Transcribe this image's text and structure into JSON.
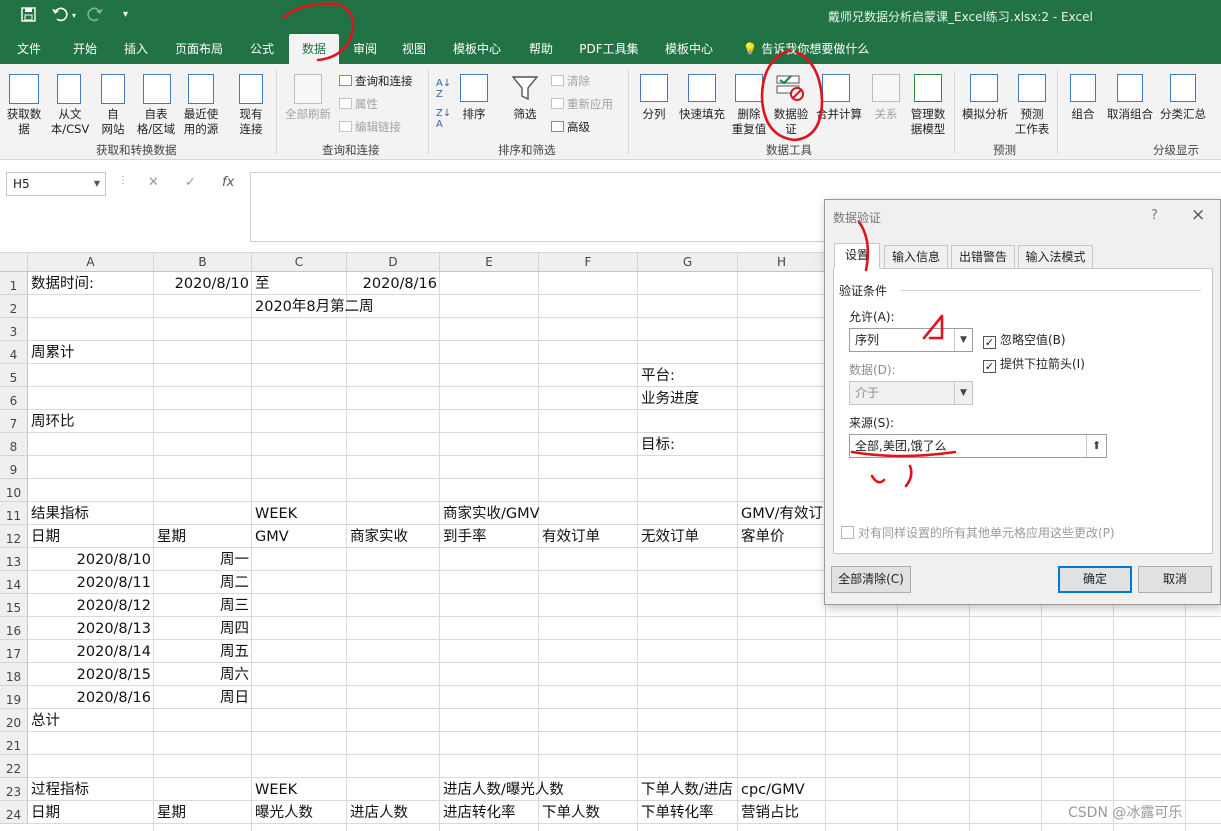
{
  "titlebar": {
    "title": "戴师兄数据分析启蒙课_Excel练习.xlsx:2  -  Excel",
    "icons": [
      "save-icon",
      "undo-icon",
      "redo-icon",
      "customize-qat-icon"
    ]
  },
  "tabs": [
    "文件",
    "开始",
    "插入",
    "页面布局",
    "公式",
    "数据",
    "审阅",
    "视图",
    "模板中心",
    "帮助",
    "PDF工具集",
    "模板中心",
    "告诉我你想要做什么"
  ],
  "active_tab": "数据",
  "ribbon": {
    "get_transform": {
      "label": "获取和转换数据",
      "buttons": [
        "获取数\n据",
        "从文\n本/CSV",
        "自\n网站",
        "自表\n格/区域",
        "最近使\n用的源",
        "现有\n连接"
      ]
    },
    "queries": {
      "label": "查询和连接",
      "refresh": "全部刷新",
      "items": [
        "查询和连接",
        "属性",
        "编辑链接"
      ]
    },
    "sort_filter": {
      "label": "排序和筛选",
      "sort": "排序",
      "filter": "筛选",
      "items": [
        "清除",
        "重新应用",
        "高级"
      ]
    },
    "data_tools": {
      "label": "数据工具",
      "buttons": [
        "分列",
        "快速填充",
        "删除\n重复值",
        "数据验\n证",
        "合并计算",
        "关系",
        "管理数\n据模型"
      ]
    },
    "forecast": {
      "label": "预测",
      "buttons": [
        "模拟分析",
        "预测\n工作表"
      ]
    },
    "outline": {
      "label": "分级显示",
      "buttons": [
        "组合",
        "取消组合",
        "分类汇总"
      ]
    }
  },
  "formula_bar": {
    "name_box": "H5",
    "formula": ""
  },
  "columns": [
    "A",
    "B",
    "C",
    "D",
    "E",
    "F",
    "G",
    "H"
  ],
  "rows": [
    "1",
    "2",
    "3",
    "4",
    "5",
    "6",
    "7",
    "8",
    "9",
    "10",
    "11",
    "12",
    "13",
    "14",
    "15",
    "16",
    "17",
    "18",
    "19",
    "20",
    "21",
    "22",
    "23",
    "24"
  ],
  "cells": {
    "A1": "数据时间:",
    "B1": "2020/8/10",
    "C1": "至",
    "D1": "2020/8/16",
    "C2": "2020年8月第二周",
    "A4": "周累计",
    "G5": "平台:",
    "G6": "业务进度",
    "A7": "周环比",
    "G8": "目标:",
    "A11": "结果指标",
    "C11": "WEEK",
    "E11": "商家实收/GMV",
    "H11": "GMV/有效订",
    "A12": "日期",
    "B12": "星期",
    "C12": "GMV",
    "D12": "商家实收",
    "E12": "到手率",
    "F12": "有效订单",
    "G12": "无效订单",
    "H12": "客单价",
    "A13": "2020/8/10",
    "B13": "周一",
    "A14": "2020/8/11",
    "B14": "周二",
    "A15": "2020/8/12",
    "B15": "周三",
    "A16": "2020/8/13",
    "B16": "周四",
    "A17": "2020/8/14",
    "B17": "周五",
    "A18": "2020/8/15",
    "B18": "周六",
    "A19": "2020/8/16",
    "B19": "周日",
    "A20": "总计",
    "A23": "过程指标",
    "C23": "WEEK",
    "E23": "进店人数/曝光人数",
    "G23": "下单人数/进店",
    "H23": "cpc/GMV",
    "A24": "日期",
    "B24": "星期",
    "C24": "曝光人数",
    "D24": "进店人数",
    "E24": "进店转化率",
    "F24": "下单人数",
    "G24": "下单转化率",
    "H24": "营销占比"
  },
  "dialog": {
    "title": "数据验证",
    "help": "?",
    "close": "×",
    "tabs": [
      "设置",
      "输入信息",
      "出错警告",
      "输入法模式"
    ],
    "section": "验证条件",
    "allow_label": "允许(A):",
    "allow_value": "序列",
    "data_label": "数据(D):",
    "data_value": "介于",
    "ignore_blank": "忽略空值(B)",
    "dropdown_arrow": "提供下拉箭头(I)",
    "source_label": "来源(S):",
    "source_value": "全部,美团,饿了么",
    "apply_all": "对有同样设置的所有其他单元格应用这些更改(P)",
    "clear_all": "全部清除(C)",
    "ok": "确定",
    "cancel": "取消"
  },
  "watermark": "CSDN @冰露可乐",
  "colors": {
    "excel_green": "#217346",
    "annotation_red": "#e0141e",
    "focus_blue": "#0078d7"
  }
}
